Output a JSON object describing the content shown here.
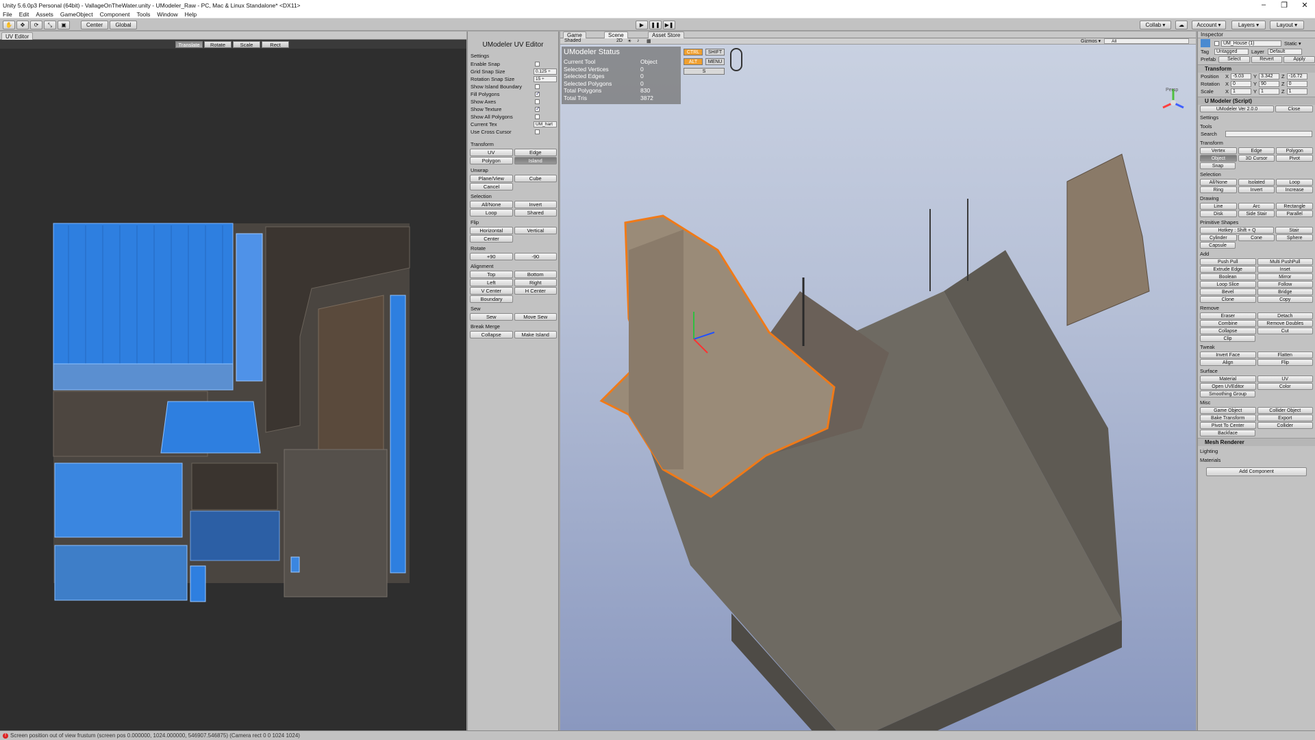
{
  "window": {
    "title": "Unity 5.6.0p3 Personal (64bit) - VallageOnTheWater.unity - UModeler_Raw - PC, Mac & Linux Standalone* <DX11>",
    "minimize": "–",
    "maximize": "❐",
    "close": "✕"
  },
  "menu": [
    "File",
    "Edit",
    "Assets",
    "GameObject",
    "Component",
    "Tools",
    "Window",
    "Help"
  ],
  "toolbar": {
    "pivot": "Center",
    "space": "Global",
    "collab": "Collab ▾",
    "account": "Account ▾",
    "layers": "Layers ▾",
    "layout": "Layout ▾"
  },
  "uv_editor": {
    "tab": "UV Editor",
    "modes": [
      "Translate",
      "Rotate",
      "Scale",
      "Rect"
    ],
    "active_mode": "Translate"
  },
  "uv_panel": {
    "title": "UModeler UV Editor",
    "settings_header": "Settings",
    "settings": [
      {
        "label": "Enable Snap",
        "type": "check",
        "checked": false
      },
      {
        "label": "Grid Snap Size",
        "type": "field",
        "value": "0.125 ÷"
      },
      {
        "label": "Rotation Snap Size",
        "type": "field",
        "value": "15 ÷"
      },
      {
        "label": "Show Island Boundary",
        "type": "check",
        "checked": false
      },
      {
        "label": "Fill Polygons",
        "type": "check",
        "checked": true
      },
      {
        "label": "Show Axes",
        "type": "check",
        "checked": false
      },
      {
        "label": "Show Texture",
        "type": "check",
        "checked": true
      },
      {
        "label": "Show All Polygons",
        "type": "check",
        "checked": false
      },
      {
        "label": "Current Tex",
        "type": "field",
        "value": "UM_hart"
      },
      {
        "label": "Use Cross Cursor",
        "type": "check",
        "checked": false
      }
    ],
    "transform_header": "Transform",
    "transform": [
      "UV",
      "Edge",
      "Polygon",
      "Island"
    ],
    "unwrap_header": "Unwrap",
    "unwrap": [
      "Plane/View",
      "Cube"
    ],
    "cancel": "Cancel",
    "selection_header": "Selection",
    "selection": [
      "All/None",
      "Invert",
      "Loop",
      "Shared"
    ],
    "flip_header": "Flip",
    "flip": [
      "Horizontal",
      "Vertical"
    ],
    "center": "Center",
    "rotate_header": "Rotate",
    "rotate": [
      "+90",
      "-90"
    ],
    "alignment_header": "Alignment",
    "alignment": [
      "Top",
      "Bottom",
      "Left",
      "Right",
      "V Center",
      "H Center"
    ],
    "boundary": "Boundary",
    "sew_header": "Sew",
    "sew": [
      "Sew",
      "Move Sew"
    ],
    "break_header": "Break Merge",
    "break": [
      "Collapse",
      "Make Island"
    ]
  },
  "scene": {
    "tabs": [
      "Game",
      "Scene",
      "Asset Store"
    ],
    "shading": "Shaded",
    "mode2d": "2D",
    "gizmos": "Gizmos ▾",
    "search": "All",
    "status_title": "UModeler Status",
    "status": [
      {
        "k": "Current Tool",
        "v": "Object"
      },
      {
        "k": "Selected Vertices",
        "v": "0"
      },
      {
        "k": "Selected Edges",
        "v": "0"
      },
      {
        "k": "Selected Polygons",
        "v": "0"
      },
      {
        "k": "Total Polygons",
        "v": "830"
      },
      {
        "k": "Total Tris",
        "v": "3872"
      }
    ],
    "keys": {
      "ctrl": "CTRL",
      "shift": "SHIFT",
      "alt": "ALT",
      "menu": "MENU",
      "s": "S"
    },
    "persp": "Persp"
  },
  "inspector": {
    "tab": "Inspector",
    "object_name": "UM_House (1)",
    "static": "Static ▾",
    "tag_label": "Tag",
    "tag": "Untagged",
    "layer_label": "Layer",
    "layer": "Default",
    "prefab_label": "Prefab",
    "prefab_btns": [
      "Select",
      "Revert",
      "Apply"
    ],
    "transform_title": "Transform",
    "position": {
      "label": "Position",
      "x": "-5.03",
      "y": "3.342",
      "z": "-16.72"
    },
    "rotation": {
      "label": "Rotation",
      "x": "0",
      "y": "90",
      "z": "0"
    },
    "scale": {
      "label": "Scale",
      "x": "1",
      "y": "1",
      "z": "1"
    },
    "script_title": "U Modeler (Script)",
    "version": "UModeler Ver 2.0.0",
    "close": "Close",
    "settings": "Settings",
    "tools": "Tools",
    "search": "Search",
    "transform_header": "Transform",
    "transform": [
      "Vertex",
      "Edge",
      "Polygon",
      "Object",
      "3D Cursor",
      "Pivot",
      "Snap"
    ],
    "selection_header": "Selection",
    "selection": [
      "All/None",
      "Isolated",
      "Loop",
      "Ring",
      "Invert",
      "Increase"
    ],
    "drawing_header": "Drawing",
    "drawing": [
      "Line",
      "Arc",
      "Rectangle",
      "Disk",
      "Side Stair",
      "Parallel"
    ],
    "primitive_header": "Primitive Shapes",
    "primitive": [
      "Hotkey : Shift + Q",
      "Stair",
      "Cylinder",
      "Cone",
      "Sphere",
      "Capsule"
    ],
    "add_header": "Add",
    "add": [
      "Push Pull",
      "Multi PushPull",
      "Extrude Edge",
      "Inset",
      "Boolean",
      "Mirror",
      "Loop Slice",
      "Follow",
      "Bevel",
      "Bridge",
      "Clone",
      "Copy"
    ],
    "remove_header": "Remove",
    "remove": [
      "Eraser",
      "Detach",
      "Combine",
      "Remove Doubles",
      "Collapse",
      "Cut",
      "Clip"
    ],
    "tweak_header": "Tweak",
    "tweak": [
      "Invert Face",
      "Flatten",
      "Align",
      "Flip"
    ],
    "surface_header": "Surface",
    "surface": [
      "Material",
      "UV",
      "Open UVEditor",
      "Color",
      "Smoothing Group"
    ],
    "misc_header": "Misc",
    "misc": [
      "Game Object",
      "Collider Object",
      "Bake Transform",
      "Export",
      "Pivot To Center",
      "Collider",
      "Backface"
    ],
    "mesh_renderer": "Mesh Renderer",
    "lighting": "Lighting",
    "materials": "Materials",
    "add_component": "Add Component"
  },
  "console": "Screen position out of view frustum (screen pos 0.000000, 1024.000000, 546907.546875) (Camera rect 0 0 1024 1024)"
}
